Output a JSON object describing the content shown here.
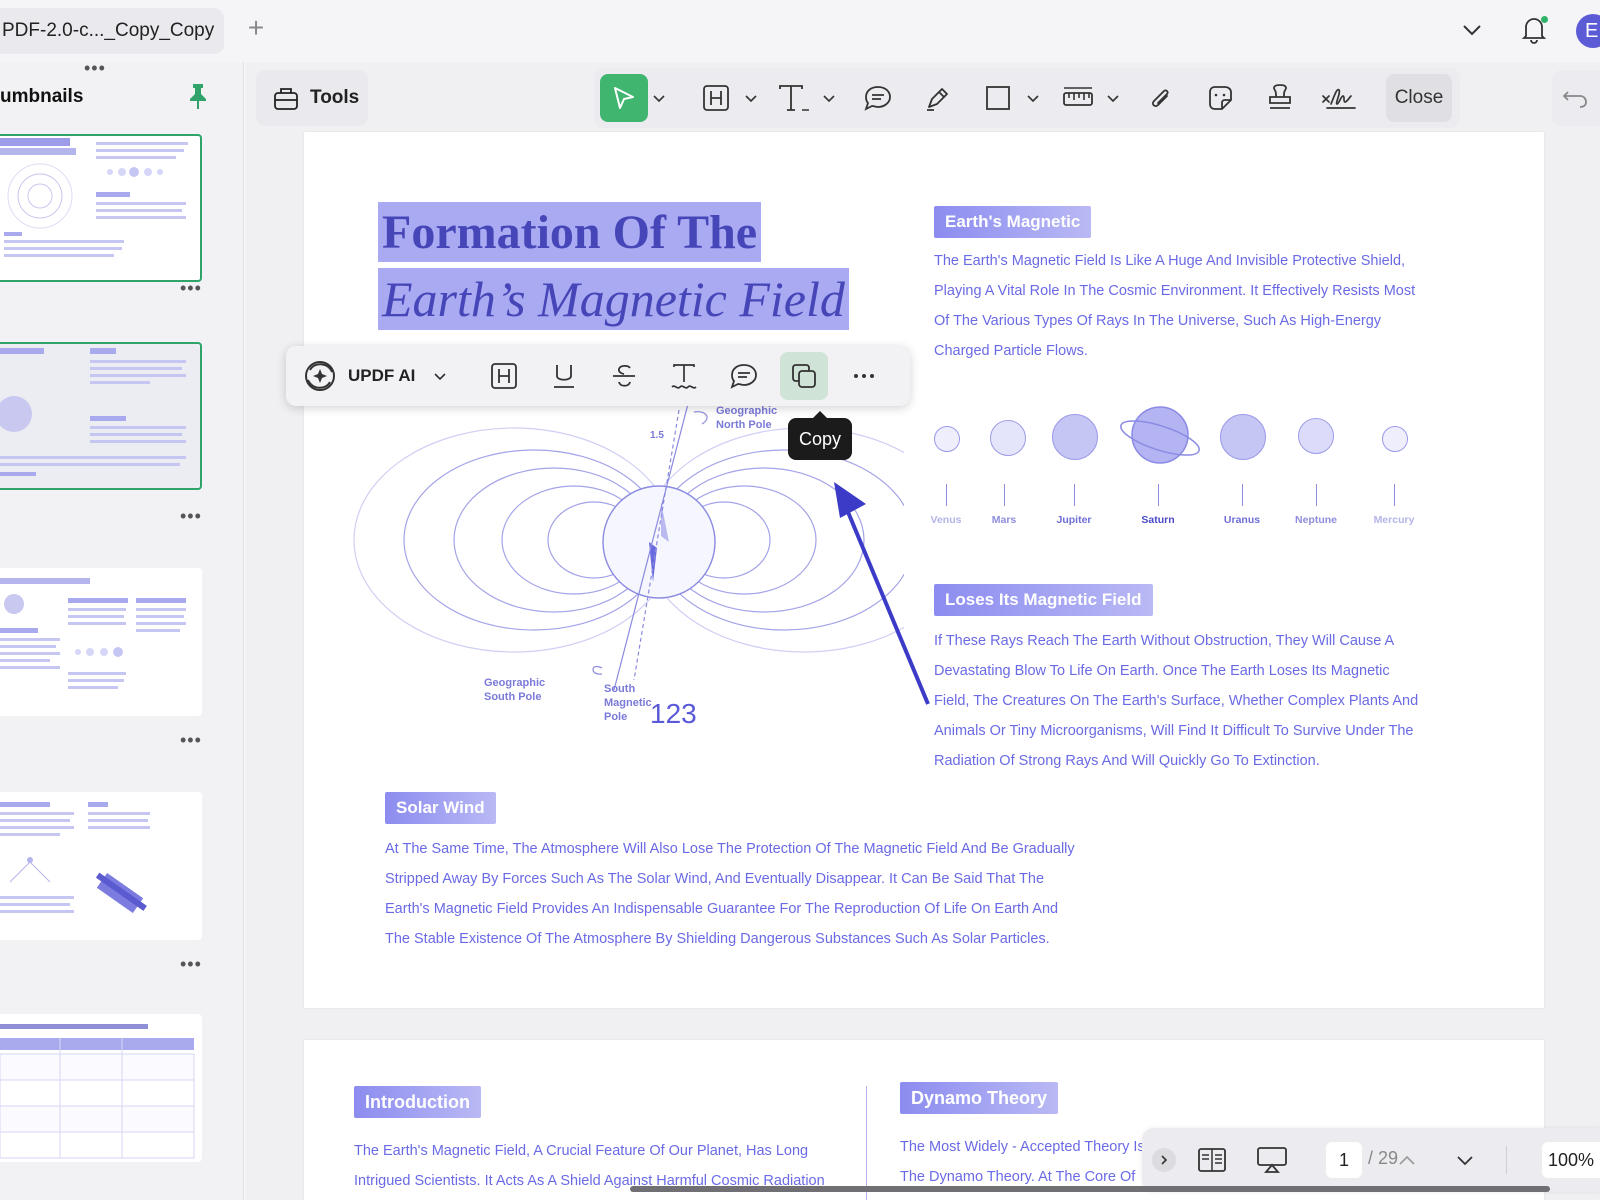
{
  "tab": {
    "title": "PDF-2.0-c..._Copy_Copy"
  },
  "user": {
    "initial": "E"
  },
  "left_panel": {
    "title": "umbnails"
  },
  "toolbar": {
    "tools_label": "Tools",
    "close_label": "Close"
  },
  "page1": {
    "title_line1": "Formation Of The",
    "title_line2": "Earth’s Magnetic Field",
    "section1": {
      "heading": "Earth's Magnetic",
      "lines": [
        "The Earth's Magnetic Field Is Like A Huge And Invisible Protective Shield,",
        "Playing A Vital Role In The Cosmic Environment. It Effectively Resists Most",
        "Of The Various Types Of Rays In The Universe, Such As High-Energy",
        "Charged Particle Flows."
      ]
    },
    "planets": [
      "Venus",
      "Mars",
      "Jupiter",
      "Saturn",
      "Uranus",
      "Neptune",
      "Mercury"
    ],
    "section2": {
      "heading": "Loses Its Magnetic Field",
      "lines": [
        "If These Rays Reach The Earth Without Obstruction, They Will Cause A",
        "Devastating Blow To Life On Earth. Once The Earth Loses Its Magnetic",
        "Field, The Creatures On The Earth's Surface, Whether Complex Plants And",
        "Animals Or Tiny Microorganisms, Will Find It Difficult To Survive Under The",
        "Radiation Of Strong Rays And Will Quickly Go To Extinction."
      ]
    },
    "section3": {
      "heading": "Solar Wind",
      "lines": [
        "At The Same Time, The Atmosphere Will Also Lose The Protection Of The Magnetic Field And Be Gradually",
        "Stripped Away By Forces Such As The Solar Wind, And Eventually Disappear. It Can Be Said That The",
        "Earth's Magnetic Field Provides An Indispensable Guarantee For The Reproduction Of Life On Earth And",
        "The Stable Existence Of The Atmosphere By Shielding Dangerous Substances Such As Solar Particles."
      ]
    },
    "diagram": {
      "north_pole_line1": "Geographic",
      "north_pole_line2": "North Pole",
      "angle_label": "1.5",
      "south_geo_line1": "Geographic",
      "south_geo_line2": "South Pole",
      "south_mag_line1": "South",
      "south_mag_line2": "Magnetic",
      "south_mag_line3": "Pole",
      "annotation": "123"
    }
  },
  "page2": {
    "intro_heading": "Introduction",
    "intro_lines": [
      "The Earth's Magnetic Field, A Crucial Feature Of Our Planet, Has Long",
      "Intrigued Scientists. It Acts As A Shield Against Harmful Cosmic Radiation"
    ],
    "dynamo_heading": "Dynamo Theory",
    "dynamo_lines": [
      "The Most Widely - Accepted Theory Is",
      "The Dynamo Theory. At The Core Of"
    ]
  },
  "floating_menu": {
    "ai_label": "UPDF AI",
    "tooltip": "Copy"
  },
  "nav": {
    "current_page": "1",
    "total": "/ 29",
    "zoom": "100%"
  },
  "colors": {
    "accent_green": "#3fb56f",
    "text_purple": "#6a6ae6",
    "highlight": "#a9aaf2"
  }
}
